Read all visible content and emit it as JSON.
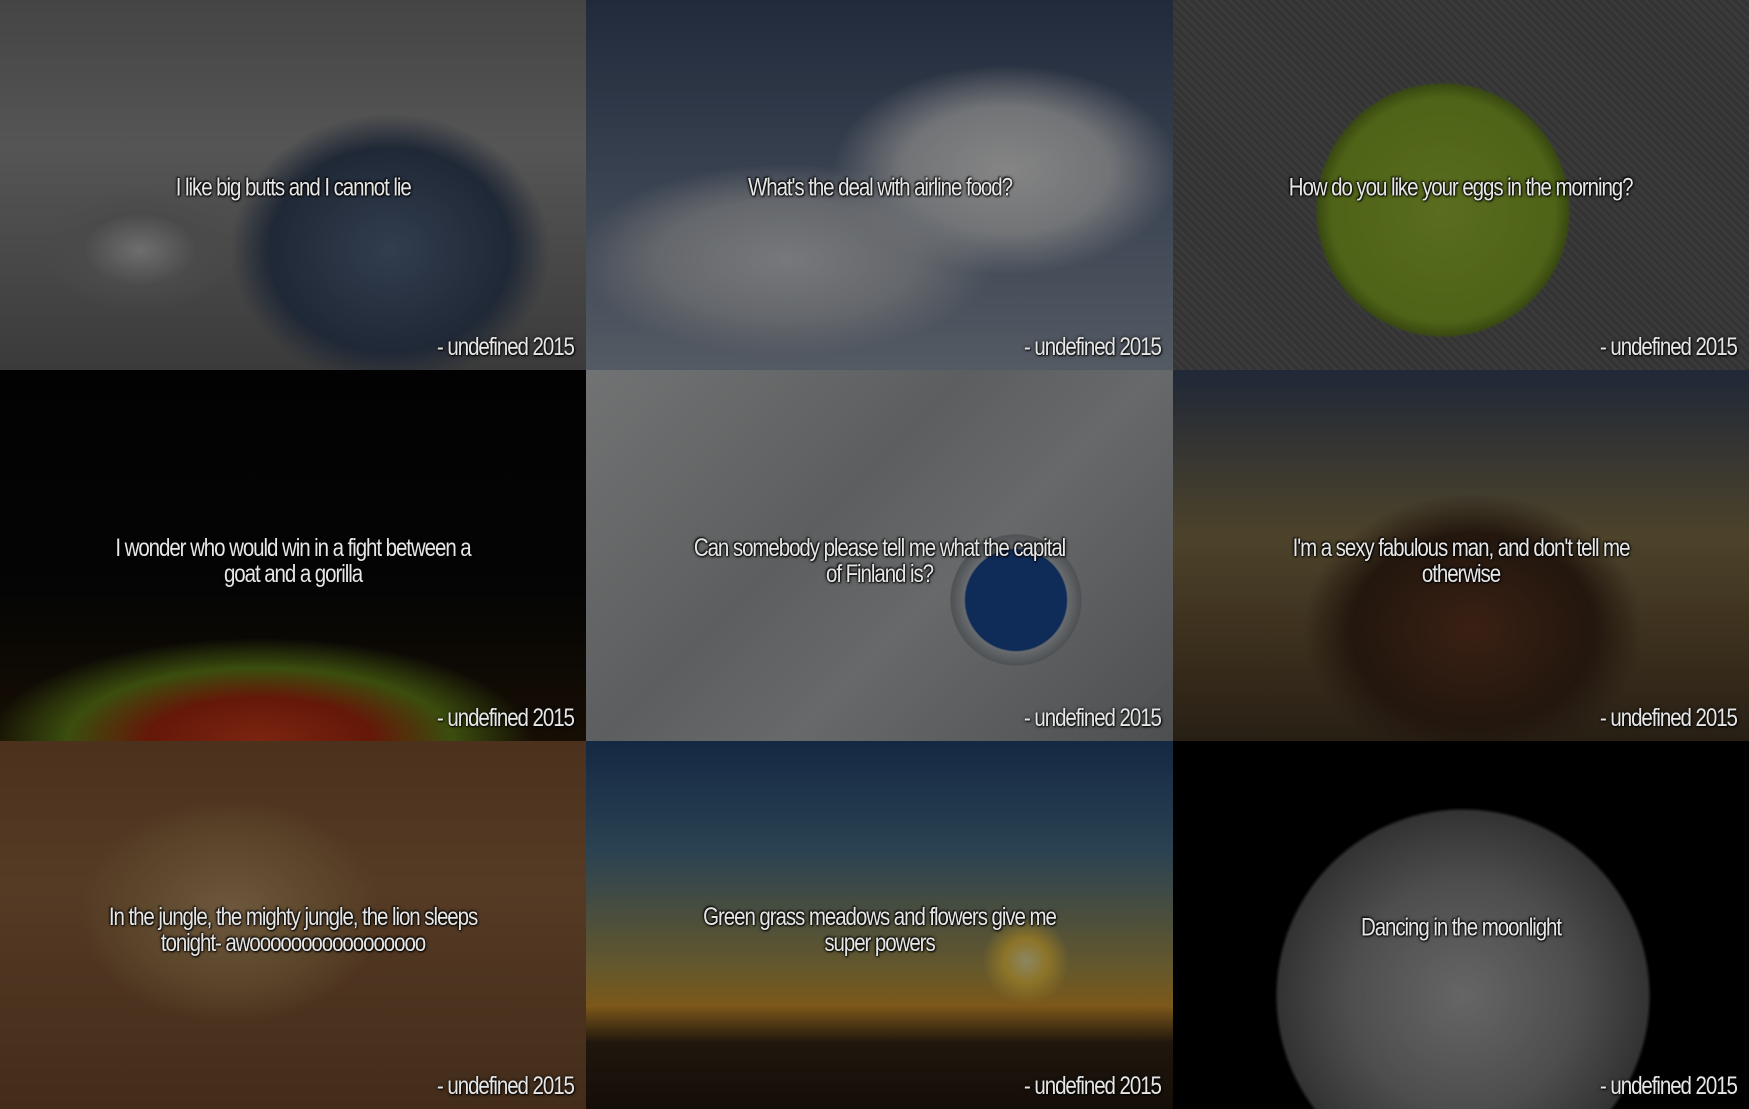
{
  "tiles": [
    {
      "quote": "I like big butts and I cannot lie",
      "author": "- undefined 2015"
    },
    {
      "quote": "What's the deal with airline food?",
      "author": "- undefined 2015"
    },
    {
      "quote": "How do you like your eggs in the morning?",
      "author": "- undefined 2015"
    },
    {
      "quote": "I wonder who would win in a fight between a goat and a gorilla",
      "author": "- undefined 2015"
    },
    {
      "quote": "Can somebody please tell me what the capital of Finland is?",
      "author": "- undefined 2015"
    },
    {
      "quote": "I'm a sexy fabulous man, and don't tell me otherwise",
      "author": "- undefined 2015"
    },
    {
      "quote": "In the jungle, the mighty jungle, the lion sleeps tonight- awooooooooooooooooo",
      "author": "- undefined 2015"
    },
    {
      "quote": "Green grass meadows and flowers give me super powers",
      "author": "- undefined 2015"
    },
    {
      "quote": "Dancing in the moonlight",
      "author": "- undefined 2015"
    }
  ]
}
